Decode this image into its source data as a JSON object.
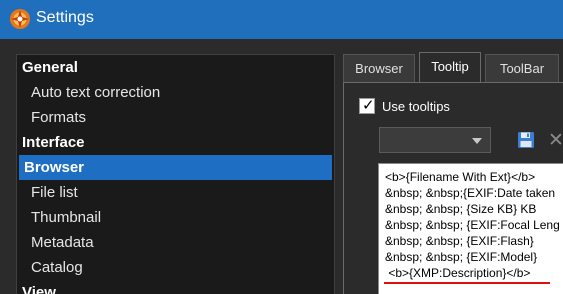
{
  "window": {
    "title": "Settings",
    "app_icon": "xnview-icon"
  },
  "tree": {
    "items": [
      {
        "label": "General",
        "kind": "category"
      },
      {
        "label": "Auto text correction",
        "kind": "item"
      },
      {
        "label": "Formats",
        "kind": "item"
      },
      {
        "label": "Interface",
        "kind": "category"
      },
      {
        "label": "Browser",
        "kind": "item",
        "selected": true
      },
      {
        "label": "File list",
        "kind": "item"
      },
      {
        "label": "Thumbnail",
        "kind": "item"
      },
      {
        "label": "Metadata",
        "kind": "item"
      },
      {
        "label": "Catalog",
        "kind": "item"
      },
      {
        "label": "View",
        "kind": "category"
      }
    ]
  },
  "tabs": [
    {
      "label": "Browser",
      "active": false
    },
    {
      "label": "Tooltip",
      "active": true
    },
    {
      "label": "ToolBar",
      "active": false
    }
  ],
  "use_tooltips": {
    "label": "Use tooltips",
    "checked": true
  },
  "preset_combo": {
    "value": ""
  },
  "toolbar_icons": [
    "save-icon",
    "close-icon"
  ],
  "editor": {
    "lines": [
      "<b>{Filename With Ext}</b>",
      "&nbsp; &nbsp;{EXIF:Date taken",
      "&nbsp; &nbsp; {Size KB} KB",
      "&nbsp; &nbsp; {EXIF:Focal Leng",
      "&nbsp; &nbsp; {EXIF:Flash}",
      "&nbsp; &nbsp; {EXIF:Model}",
      " <b>{XMP:Description}</b>"
    ]
  },
  "colors": {
    "titlebar": "#1f6fbd",
    "selection": "#1e6fc3",
    "underline": "#e01010"
  }
}
